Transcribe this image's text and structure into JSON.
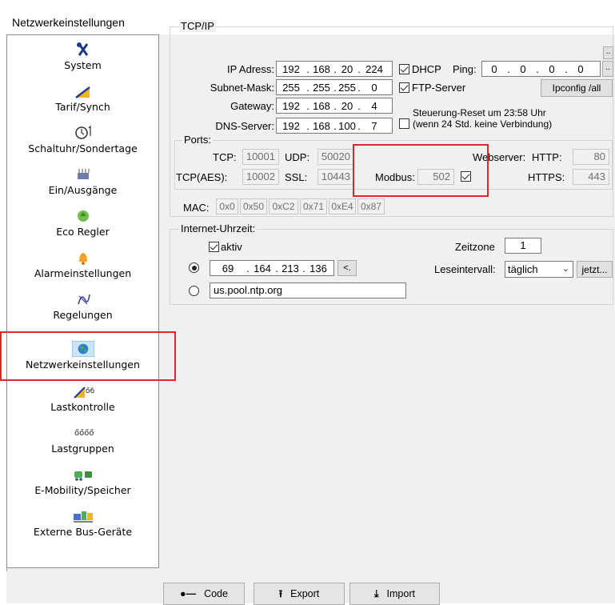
{
  "window": {
    "title": "Netzwerkeinstellungen"
  },
  "sidebar": {
    "items": [
      {
        "label": "System",
        "icon": "tools-icon"
      },
      {
        "label": "Tarif/Synch",
        "icon": "tariff-icon"
      },
      {
        "label": "Schaltuhr/Sondertage",
        "icon": "timer-icon"
      },
      {
        "label": "Ein/Ausgänge",
        "icon": "io-icon"
      },
      {
        "label": "Eco Regler",
        "icon": "eco-recycle-icon"
      },
      {
        "label": "Alarmeinstellungen",
        "icon": "alarm-bell-icon"
      },
      {
        "label": "Regelungen",
        "icon": "control-icon"
      },
      {
        "label": "Netzwerkeinstellungen",
        "icon": "globe-icon",
        "selected": true
      },
      {
        "label": "Lastkontrolle",
        "icon": "load-control-icon"
      },
      {
        "label": "Lastgruppen",
        "icon": "load-groups-icon"
      },
      {
        "label": "E-Mobility/Speicher",
        "icon": "emobility-icon"
      },
      {
        "label": "Externe Bus-Geräte",
        "icon": "bus-devices-icon"
      }
    ]
  },
  "tcpip": {
    "legend": "TCP/IP",
    "ip_label": "IP Adress:",
    "ip": [
      "192",
      "168",
      "20",
      "224"
    ],
    "subnet_label": "Subnet-Mask:",
    "subnet": [
      "255",
      "255",
      "255",
      "0"
    ],
    "gateway_label": "Gateway:",
    "gateway": [
      "192",
      "168",
      "20",
      "4"
    ],
    "dns_label": "DNS-Server:",
    "dns": [
      "192",
      "168",
      "100",
      "7"
    ],
    "dhcp_label": "DHCP",
    "dhcp_checked": true,
    "ping_label": "Ping:",
    "ping": [
      "0",
      "0",
      "0",
      "0"
    ],
    "ping_btn": "..",
    "ftp_label": "FTP-Server",
    "ftp_checked": true,
    "ipconfig_btn": "Ipconfig /all",
    "reset_label_1": "Steuerung-Reset um 23:58 Uhr",
    "reset_label_2": "(wenn 24 Std. keine Verbindung)",
    "reset_checked": false,
    "ports": {
      "legend": "Ports:",
      "tcp_label": "TCP:",
      "tcp": "10001",
      "udp_label": "UDP:",
      "udp": "50020",
      "tcpaes_label": "TCP(AES):",
      "tcpaes": "10002",
      "ssl_label": "SSL:",
      "ssl": "10443",
      "modbus_label": "Modbus:",
      "modbus": "502",
      "modbus_checked": true,
      "webserver_label": "Webserver:",
      "http_label": "HTTP:",
      "http": "80",
      "https_label": "HTTPS:",
      "https": "443"
    },
    "mac_label": "MAC:",
    "mac": [
      "0x0",
      "0x50",
      "0xC2",
      "0x71",
      "0xE4",
      "0x87"
    ]
  },
  "time": {
    "legend": "Internet-Uhrzeit:",
    "aktiv_label": "aktiv",
    "aktiv_checked": true,
    "zeitzone_label": "Zeitzone",
    "zeitzone": "1",
    "ip": [
      "69",
      "164",
      "213",
      "136"
    ],
    "ip_btn": "<.",
    "leseintervall_label": "Leseintervall:",
    "leseintervall": "täglich",
    "jetzt_btn": "jetzt...",
    "server": "us.pool.ntp.org"
  },
  "footer": {
    "code": "Code",
    "export": "Export",
    "import": "Import"
  },
  "colors": {
    "highlight": "#e0262c",
    "selection": "#cce4f7"
  }
}
